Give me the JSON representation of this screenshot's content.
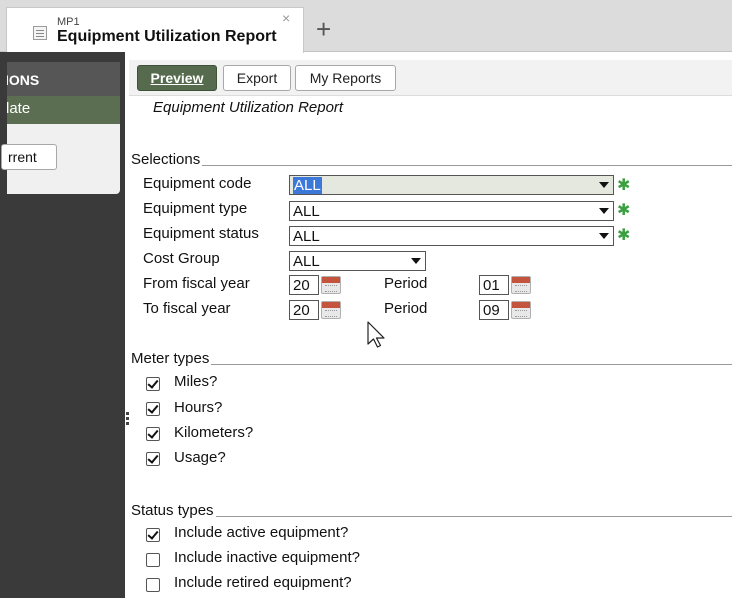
{
  "tab": {
    "subtitle": "MP1",
    "title": "Equipment Utilization Report",
    "close_glyph": "×",
    "new_tab_glyph": "+"
  },
  "sidebar": {
    "header": "IONS",
    "active_item": "late",
    "button": "rrent"
  },
  "toolbar": {
    "preview_label": "Preview",
    "export_label": "Export",
    "reports_label": "My Reports"
  },
  "report_title": "Equipment Utilization Report",
  "selections": {
    "group_title": "Selections",
    "equipment_code": {
      "label": "Equipment code",
      "value": "ALL"
    },
    "equipment_type": {
      "label": "Equipment type",
      "value": "ALL"
    },
    "equipment_status": {
      "label": "Equipment status",
      "value": "ALL"
    },
    "cost_group": {
      "label": "Cost Group",
      "value": "ALL"
    },
    "from_fiscal_year": {
      "label": "From fiscal year",
      "value": "20",
      "period_label": "Period",
      "period": "01"
    },
    "to_fiscal_year": {
      "label": "To fiscal year",
      "value": "20",
      "period_label": "Period",
      "period": "09"
    },
    "required_glyph": "✱"
  },
  "meter_types": {
    "group_title": "Meter types",
    "items": [
      {
        "label": "Miles?",
        "checked": true
      },
      {
        "label": "Hours?",
        "checked": true
      },
      {
        "label": "Kilometers?",
        "checked": true
      },
      {
        "label": "Usage?",
        "checked": true
      }
    ]
  },
  "status_types": {
    "group_title": "Status types",
    "items": [
      {
        "label": "Include active equipment?",
        "checked": true
      },
      {
        "label": "Include inactive equipment?",
        "checked": false
      },
      {
        "label": "Include retired equipment?",
        "checked": false
      }
    ]
  },
  "colors": {
    "accent_green": "#566b4d",
    "required_star": "#3aa040",
    "selection_highlight": "#3c78d8",
    "sidebar_bg": "#3a3a3a"
  },
  "icons": [
    "document-icon",
    "close-icon",
    "plus-icon",
    "calendar-icon",
    "checkbox-icon",
    "mouse-cursor-icon"
  ]
}
